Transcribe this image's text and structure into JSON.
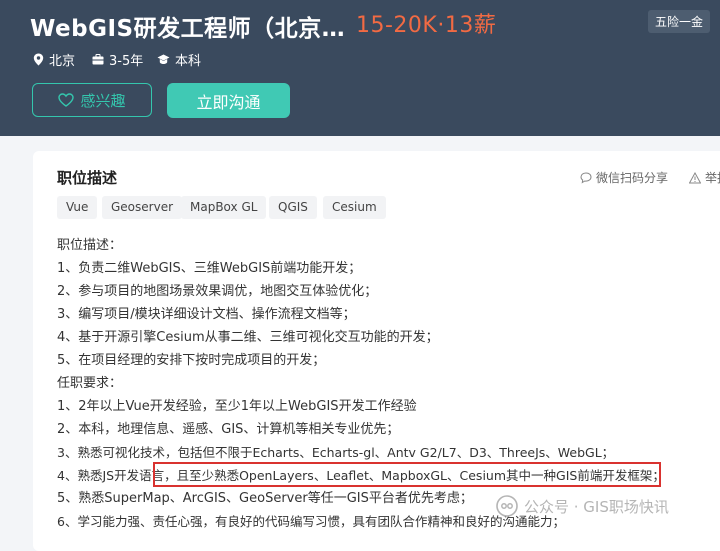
{
  "header": {
    "title": "WebGIS研发工程师（北京…",
    "salary": "15-20K·13薪",
    "benefit_badge": "五险一金",
    "meta": {
      "location": "北京",
      "experience": "3-5年",
      "education": "本科"
    },
    "buttons": {
      "interested": "感兴趣",
      "chat": "立即沟通"
    }
  },
  "card": {
    "section_title": "职位描述",
    "share_label": "微信扫码分享",
    "report_label": "举报",
    "tags": [
      "Vue",
      "Geoserver",
      "MapBox GL",
      "QGIS",
      "Cesium"
    ],
    "description": [
      "职位描述：",
      "1、负责二维WebGIS、三维WebGIS前端功能开发；",
      "2、参与项目的地图场景效果调优，地图交互体验优化；",
      "3、编写项目/模块详细设计文档、操作流程文档等；",
      "4、基于开源引擎Cesium从事二维、三维可视化交互功能的开发；",
      "5、在项目经理的安排下按时完成项目的开发；",
      "任职要求：",
      "1、2年以上Vue开发经验，至少1年以上WebGIS开发工作经验",
      "2、本科，地理信息、遥感、GIS、计算机等相关专业优先；",
      "3、熟悉可视化技术，包括但不限于Echarts、Echarts-gl、Antv G2/L7、D3、ThreeJs、WebGL；",
      "4、熟悉JS开发语言，且至少熟悉OpenLayers、Leaflet、MapboxGL、Cesium其中一种GIS前端开发框架；",
      "5、熟悉SuperMap、ArcGIS、GeoServer等任一GIS平台者优先考虑；",
      "6、学习能力强、责任心强，有良好的代码编写习惯，具有团队合作精神和良好的沟通能力；"
    ]
  },
  "watermark": "公众号 · GIS职场快讯",
  "colors": {
    "header_bg": "#3a4a5e",
    "accent_teal": "#40c9b4",
    "salary_orange": "#f26a43",
    "highlight_red": "#d9322f"
  }
}
